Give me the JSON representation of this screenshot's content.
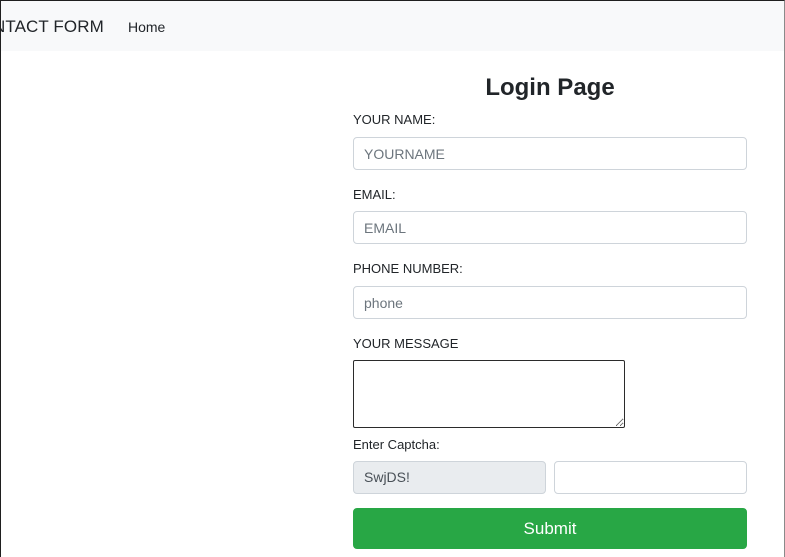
{
  "navbar": {
    "brand": "NTACT FORM",
    "links": [
      {
        "label": "Home"
      }
    ]
  },
  "form": {
    "title": "Login Page",
    "name": {
      "label": "YOUR NAME:",
      "placeholder": "YOURNAME",
      "value": ""
    },
    "email": {
      "label": "EMAIL:",
      "placeholder": "EMAIL",
      "value": ""
    },
    "phone": {
      "label": "PHONE NUMBER:",
      "placeholder": "phone",
      "value": ""
    },
    "message": {
      "label": "YOUR MESSAGE",
      "value": ""
    },
    "captcha": {
      "label": "Enter Captcha:",
      "code": "SwjDS!",
      "value": ""
    },
    "submit_label": "Submit"
  },
  "colors": {
    "navbar_bg": "#f8f9fa",
    "submit_bg": "#28a745",
    "captcha_bg": "#e9ecef",
    "input_border": "#ced4da"
  }
}
